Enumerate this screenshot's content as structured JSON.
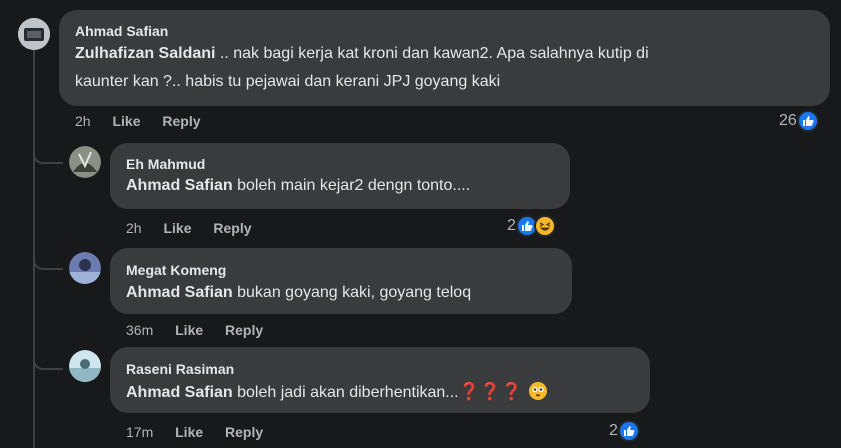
{
  "comment": {
    "author": "Ahmad Safian",
    "mention": "Zulhafizan Saldani",
    "line1": " .. nak bagi kerja kat kroni dan kawan2. Apa salahnya kutip di",
    "line2": "kaunter kan ?.. habis tu pejawai dan kerani JPJ goyang kaki",
    "time": "2h",
    "like": "Like",
    "reply": "Reply",
    "reaction_count": "26",
    "reaction_icons": [
      "like-icon"
    ]
  },
  "replies": [
    {
      "author": "Eh Mahmud",
      "mention": "Ahmad Safian",
      "text": " boleh main kejar2 dengn tonto....",
      "time": "2h",
      "like": "Like",
      "reply": "Reply",
      "reaction_count": "2",
      "reaction_icons": [
        "like-icon",
        "haha-icon"
      ]
    },
    {
      "author": "Megat Komeng",
      "mention": "Ahmad Safian",
      "text": " bukan goyang kaki, goyang teloq",
      "time": "36m",
      "like": "Like",
      "reply": "Reply"
    },
    {
      "author": "Raseni Rasiman",
      "mention": "Ahmad Safian",
      "text": " boleh jadi akan diberhentikan...",
      "emoji_suffix": "❓❓❓",
      "time": "17m",
      "like": "Like",
      "reply": "Reply",
      "reaction_count": "2",
      "reaction_icons": [
        "like-icon"
      ]
    }
  ],
  "colors": {
    "background": "#18191a",
    "bubble": "#3a3b3c",
    "secondary_text": "#b0b3b8",
    "like_blue": "#1877f2",
    "haha_yellow": "#f7b928"
  }
}
